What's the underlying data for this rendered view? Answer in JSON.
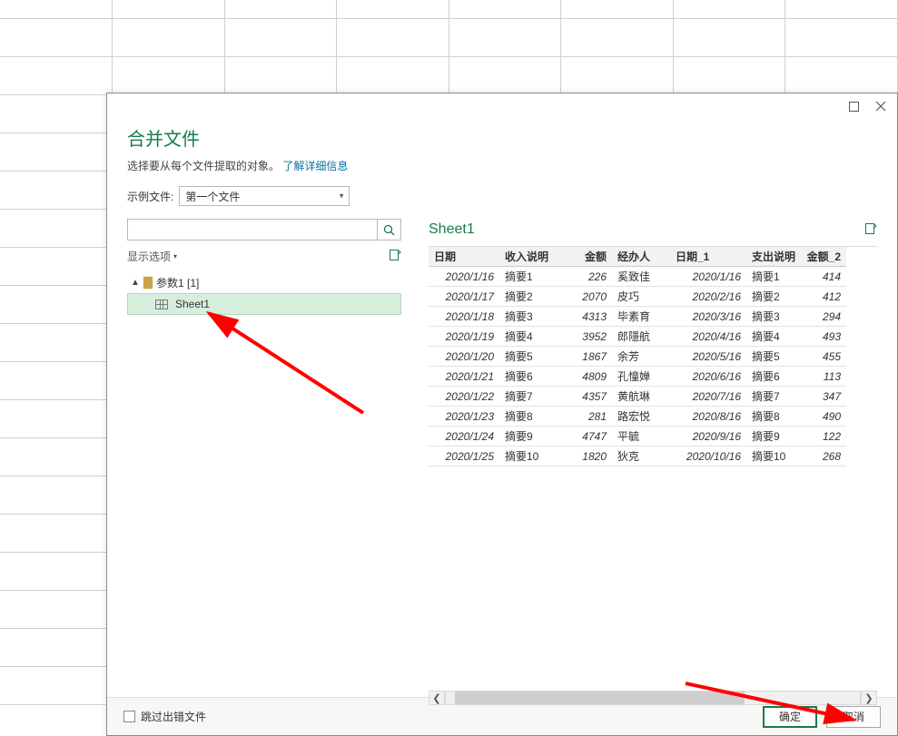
{
  "dialog": {
    "title": "合并文件",
    "subtitle_text": "选择要从每个文件提取的对象。",
    "learn_more": "了解详细信息",
    "sample_label": "示例文件:",
    "sample_value": "第一个文件",
    "display_options": "显示选项",
    "tree": {
      "folder": "参数1 [1]",
      "sheet": "Sheet1"
    },
    "preview_title": "Sheet1",
    "skip_errors": "跳过出错文件",
    "ok": "确定",
    "cancel": "取消"
  },
  "columns": [
    "日期",
    "收入说明",
    "金额",
    "经办人",
    "日期_1",
    "支出说明",
    "金额_2"
  ],
  "rows": [
    {
      "date": "2020/1/16",
      "desc": "摘要1",
      "amt": 226,
      "person": "奚致佳",
      "date2": "2020/1/16",
      "desc2": "摘要1",
      "amt2": 414
    },
    {
      "date": "2020/1/17",
      "desc": "摘要2",
      "amt": 2070,
      "person": "皮巧",
      "date2": "2020/2/16",
      "desc2": "摘要2",
      "amt2": 412
    },
    {
      "date": "2020/1/18",
      "desc": "摘要3",
      "amt": 4313,
      "person": "毕素育",
      "date2": "2020/3/16",
      "desc2": "摘要3",
      "amt2": 294
    },
    {
      "date": "2020/1/19",
      "desc": "摘要4",
      "amt": 3952,
      "person": "郎隱航",
      "date2": "2020/4/16",
      "desc2": "摘要4",
      "amt2": 493
    },
    {
      "date": "2020/1/20",
      "desc": "摘要5",
      "amt": 1867,
      "person": "余芳",
      "date2": "2020/5/16",
      "desc2": "摘要5",
      "amt2": 455
    },
    {
      "date": "2020/1/21",
      "desc": "摘要6",
      "amt": 4809,
      "person": "孔憧婵",
      "date2": "2020/6/16",
      "desc2": "摘要6",
      "amt2": 113
    },
    {
      "date": "2020/1/22",
      "desc": "摘要7",
      "amt": 4357,
      "person": "黄航琳",
      "date2": "2020/7/16",
      "desc2": "摘要7",
      "amt2": 347
    },
    {
      "date": "2020/1/23",
      "desc": "摘要8",
      "amt": 281,
      "person": "路宏悦",
      "date2": "2020/8/16",
      "desc2": "摘要8",
      "amt2": 490
    },
    {
      "date": "2020/1/24",
      "desc": "摘要9",
      "amt": 4747,
      "person": "平毓",
      "date2": "2020/9/16",
      "desc2": "摘要9",
      "amt2": 122
    },
    {
      "date": "2020/1/25",
      "desc": "摘要10",
      "amt": 1820,
      "person": "狄克",
      "date2": "2020/10/16",
      "desc2": "摘要10",
      "amt2": 268
    }
  ]
}
